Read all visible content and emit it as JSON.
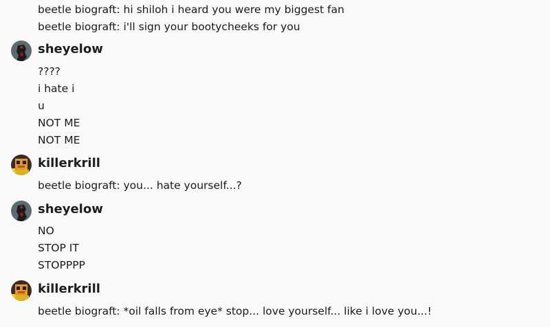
{
  "messages": [
    {
      "continuation": true,
      "lines": [
        "beetle biograft: hi shiloh i heard you were my biggest fan",
        "beetle biograft: i'll sign your bootycheeks for you"
      ]
    },
    {
      "author": "sheyelow",
      "avatar_icon": "dark-avatar-icon",
      "lines": [
        "????",
        "i hate i",
        "u",
        "NOT ME",
        "NOT ME"
      ]
    },
    {
      "author": "killerkrill",
      "avatar_icon": "orange-avatar-icon",
      "lines": [
        "beetle biograft: you... hate yourself...?"
      ]
    },
    {
      "author": "sheyelow",
      "avatar_icon": "dark-avatar-icon",
      "lines": [
        "NO",
        "STOP IT",
        "STOPPPP"
      ]
    },
    {
      "author": "killerkrill",
      "avatar_icon": "orange-avatar-icon",
      "lines": [
        "beetle biograft: *oil falls from eye* stop... love yourself... like i love you...!"
      ]
    }
  ],
  "colors": {
    "background": "#f9f9f9",
    "text": "#1a1a1a"
  }
}
